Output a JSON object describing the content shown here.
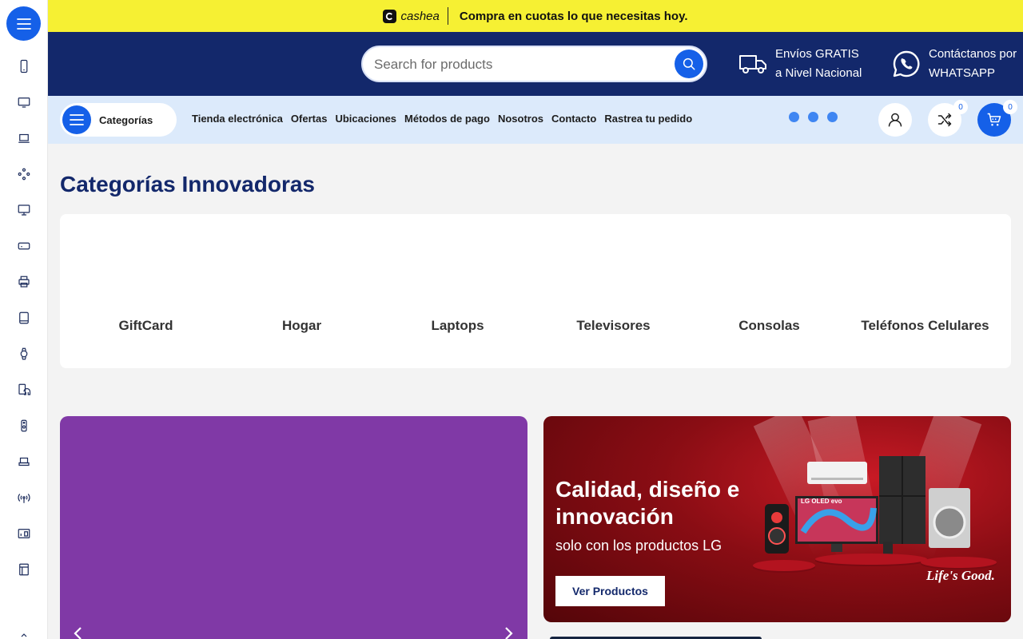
{
  "promo": {
    "brand": "cashea",
    "message": "Compra en cuotas lo que necesitas hoy."
  },
  "header": {
    "search_placeholder": "Search for products",
    "shipping_line1": "Envíos GRATIS",
    "shipping_line2": "a Nivel Nacional",
    "contact_line1": "Contáctanos por",
    "contact_line2": "WHATSAPP"
  },
  "rail": {
    "icons": [
      "phone-icon",
      "tv-icon",
      "laptop-icon",
      "gamepad-icon",
      "monitor-icon",
      "storage-icon",
      "printer-icon",
      "tablet-icon",
      "smartwatch-icon",
      "headset-icon",
      "speaker-icon",
      "devices-icon",
      "wifi-icon",
      "appliance-icon",
      "card-icon"
    ]
  },
  "nav": {
    "categories_label": "Categorías",
    "links": [
      "Tienda electrónica",
      "Ofertas",
      "Ubicaciones",
      "Métodos de pago",
      "Nosotros",
      "Contacto",
      "Rastrea tu pedido"
    ],
    "compare_count": "0",
    "cart_count": "0"
  },
  "categories": {
    "title": "Categorías Innovadoras",
    "items": [
      "GiftCard",
      "Hogar",
      "Laptops",
      "Televisores",
      "Consolas",
      "Teléfonos Celulares"
    ]
  },
  "banner": {
    "title": "Calidad, diseño e innovación",
    "subtitle": "solo con los productos LG",
    "button": "Ver Productos",
    "tagline": "Life's Good.",
    "tv_label": "LG OLED evo"
  },
  "colors": {
    "accent": "#1560e8",
    "header_bg": "#13286b",
    "promo_bg": "#f6f033",
    "nav_bg": "#dceafb",
    "promo_banner_bg": "#8039a6",
    "lg_banner_bg": "#8a0d14"
  }
}
